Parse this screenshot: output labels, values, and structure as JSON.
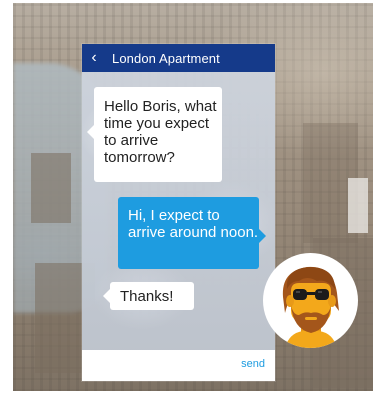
{
  "chat": {
    "header_title": "London Apartment",
    "messages": [
      {
        "from": "other",
        "text": "Hello Boris, what time you expect to arrive tomorrow?"
      },
      {
        "from": "me",
        "text": "Hi, I expect to arrive around noon."
      },
      {
        "from": "other",
        "text": "Thanks!"
      }
    ],
    "send_label": "send"
  },
  "icons": {
    "back": "chevron-left-icon",
    "avatar": "bearded-man-with-sunglasses-avatar"
  },
  "colors": {
    "header_bg": "#153a8a",
    "outgoing_bubble": "#1e9ce0",
    "incoming_bubble": "#ffffff",
    "send_text": "#1e9ce0",
    "avatar_hair": "#a4561b",
    "avatar_skin": "#f3a81b"
  }
}
